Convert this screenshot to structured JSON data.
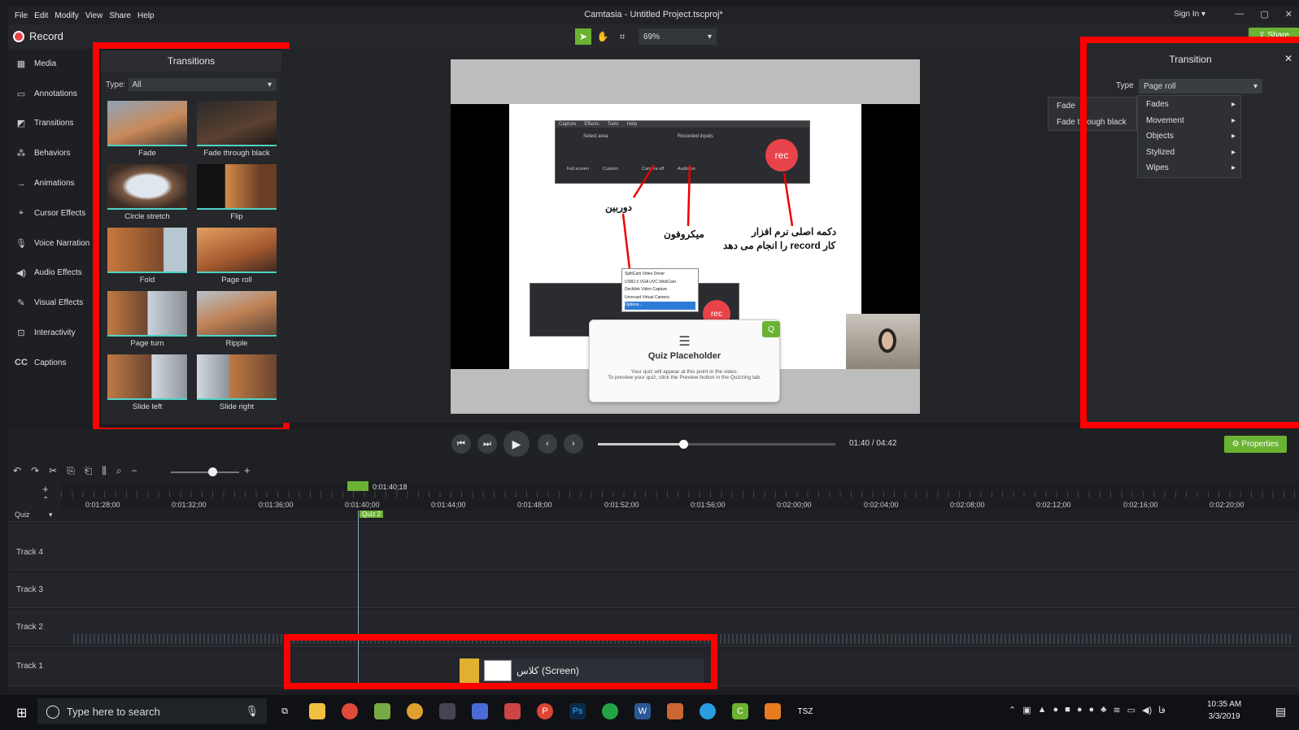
{
  "menu": {
    "items": [
      "File",
      "Edit",
      "Modify",
      "View",
      "Share",
      "Help"
    ]
  },
  "app_title": "Camtasia - Untitled Project.tscproj*",
  "signin": "Sign In ▾",
  "window_controls": [
    "—",
    "▢",
    "✕"
  ],
  "toolbar": {
    "record_label": "Record",
    "zoom": "69%",
    "share_label": "Share"
  },
  "sidebar": {
    "items": [
      {
        "label": "Media",
        "icon": "film-icon"
      },
      {
        "label": "Annotations",
        "icon": "annotation-icon"
      },
      {
        "label": "Transitions",
        "icon": "transition-icon"
      },
      {
        "label": "Behaviors",
        "icon": "behavior-icon"
      },
      {
        "label": "Animations",
        "icon": "animation-icon"
      },
      {
        "label": "Cursor Effects",
        "icon": "cursor-icon"
      },
      {
        "label": "Voice Narration",
        "icon": "mic-icon"
      },
      {
        "label": "Audio Effects",
        "icon": "speaker-icon"
      },
      {
        "label": "Visual Effects",
        "icon": "wand-icon"
      },
      {
        "label": "Interactivity",
        "icon": "interactive-icon"
      },
      {
        "label": "Captions",
        "icon": "cc-icon"
      }
    ]
  },
  "transitions_panel": {
    "title": "Transitions",
    "type_label": "Type:",
    "type_value": "All",
    "items": [
      "Fade",
      "Fade through black",
      "Circle stretch",
      "Flip",
      "Fold",
      "Page roll",
      "Page turn",
      "Ripple",
      "Slide left",
      "Slide right"
    ]
  },
  "preview": {
    "capture_menu": [
      "Capture",
      "Effects",
      "Tools",
      "Help"
    ],
    "select_area": "Select area",
    "recorded_inputs": "Recorded inputs",
    "full_screen": "Full screen",
    "custom": "Custom",
    "camera_off": "Camera off",
    "audio_on": "Audio on",
    "rec": "rec",
    "ann_camera": "دوربین",
    "ann_mic": "میکروفون",
    "ann_rec_line1": "دکمه اصلی نرم افزار",
    "ann_rec_line2": "کار record را انجام می دهد",
    "dropdown": [
      "SplitCam Video Driver",
      "USB2.0 VGA UVC WebCam",
      "Decklink Video Capture",
      "Unrecast Virtual Camera",
      "Options..."
    ],
    "quiz_title": "Quiz Placeholder",
    "quiz_line1": "Your quiz will appear at this point in the video.",
    "quiz_line2": "To preview your quiz, click the Preview button in the Quizzing tab."
  },
  "transition_panel": {
    "title": "Transition",
    "type_label": "Type",
    "type_value": "Page roll",
    "submenu": [
      "Fades",
      "Movement",
      "Objects",
      "Stylized",
      "Wipes"
    ],
    "flyout": [
      "Fade",
      "Fade through black"
    ]
  },
  "playback": {
    "current": "01:40",
    "separator": "/",
    "total": "04:42",
    "progress": 0.36,
    "properties_label": "Properties"
  },
  "timeline": {
    "playhead": "0:01:40;18",
    "ticks": [
      "0:01:28;00",
      "0:01:32;00",
      "0:01:36;00",
      "0:01:40;00",
      "0:01:44;00",
      "0:01:48;00",
      "0:01:52;00",
      "0:01:56;00",
      "0:02:00;00",
      "0:02:04;00",
      "0:02:08;00",
      "0:02:12;00",
      "0:02:16;00",
      "0:02:20;00"
    ],
    "quiz_label": "Quiz",
    "quiz_marker": "Quiz 2",
    "tracks": [
      "Track 4",
      "Track 3",
      "Track 2",
      "Track 1"
    ],
    "clip_label": "کلاس (Screen)"
  },
  "taskbar": {
    "search_placeholder": "Type here to search",
    "time": "10:35 AM",
    "date": "3/3/2019",
    "lang": "فا"
  },
  "colors": {
    "accent_green": "#6bb232",
    "highlight_red": "#ff0000",
    "teal": "#4fd1c5"
  }
}
